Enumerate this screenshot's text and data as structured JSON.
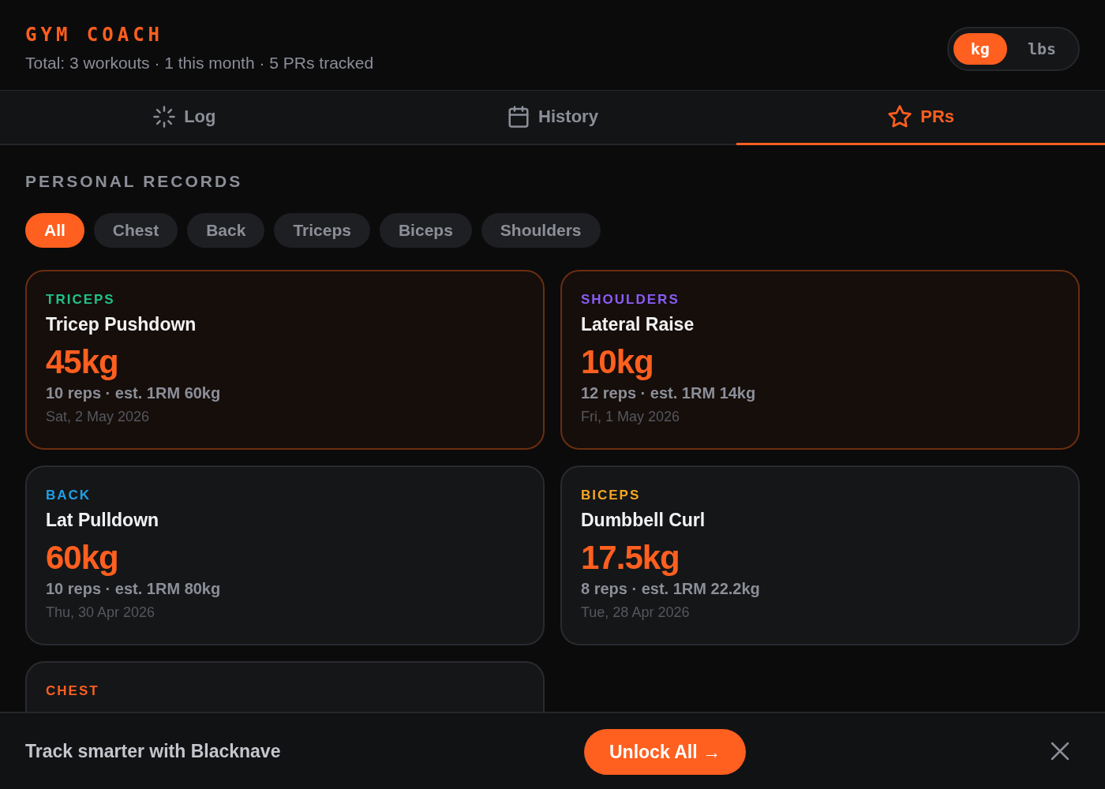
{
  "app": {
    "title": "GYM COACH",
    "summary": "Total: 3 workouts · 1 this month · 5 PRs tracked"
  },
  "units": [
    {
      "label": "kg",
      "selected": true
    },
    {
      "label": "lbs",
      "selected": false
    }
  ],
  "tabs": [
    {
      "label": "Log",
      "kind": "log",
      "selected": false
    },
    {
      "label": "History",
      "kind": "history",
      "selected": false
    },
    {
      "label": "PRs",
      "kind": "prs",
      "selected": true
    }
  ],
  "section_title": "PERSONAL RECORDS",
  "filters": [
    {
      "label": "All",
      "selected": true
    },
    {
      "label": "Chest",
      "selected": false
    },
    {
      "label": "Back",
      "selected": false
    },
    {
      "label": "Triceps",
      "selected": false
    },
    {
      "label": "Biceps",
      "selected": false
    },
    {
      "label": "Shoulders",
      "selected": false
    }
  ],
  "records": [
    {
      "muscle": "TRICEPS",
      "color": "#22c08a",
      "exercise": "Tricep Pushdown",
      "weight": "45kg",
      "detail": "10 reps · est. 1RM 60kg",
      "date": "Sat, 2 May 2026",
      "recent": true
    },
    {
      "muscle": "SHOULDERS",
      "color": "#8b5cf6",
      "exercise": "Lateral Raise",
      "weight": "10kg",
      "detail": "12 reps · est. 1RM 14kg",
      "date": "Fri, 1 May 2026",
      "recent": true
    },
    {
      "muscle": "BACK",
      "color": "#1ea0e6",
      "exercise": "Lat Pulldown",
      "weight": "60kg",
      "detail": "10 reps · est. 1RM 80kg",
      "date": "Thu, 30 Apr 2026",
      "recent": false
    },
    {
      "muscle": "BICEPS",
      "color": "#f5a623",
      "exercise": "Dumbbell Curl",
      "weight": "17.5kg",
      "detail": "8 reps · est. 1RM 22.2kg",
      "date": "Tue, 28 Apr 2026",
      "recent": false
    },
    {
      "muscle": "CHEST",
      "color": "#ff5f1f",
      "recent": false
    }
  ],
  "banner": {
    "text": "Track smarter with Blacknave",
    "button": "Unlock All →"
  }
}
